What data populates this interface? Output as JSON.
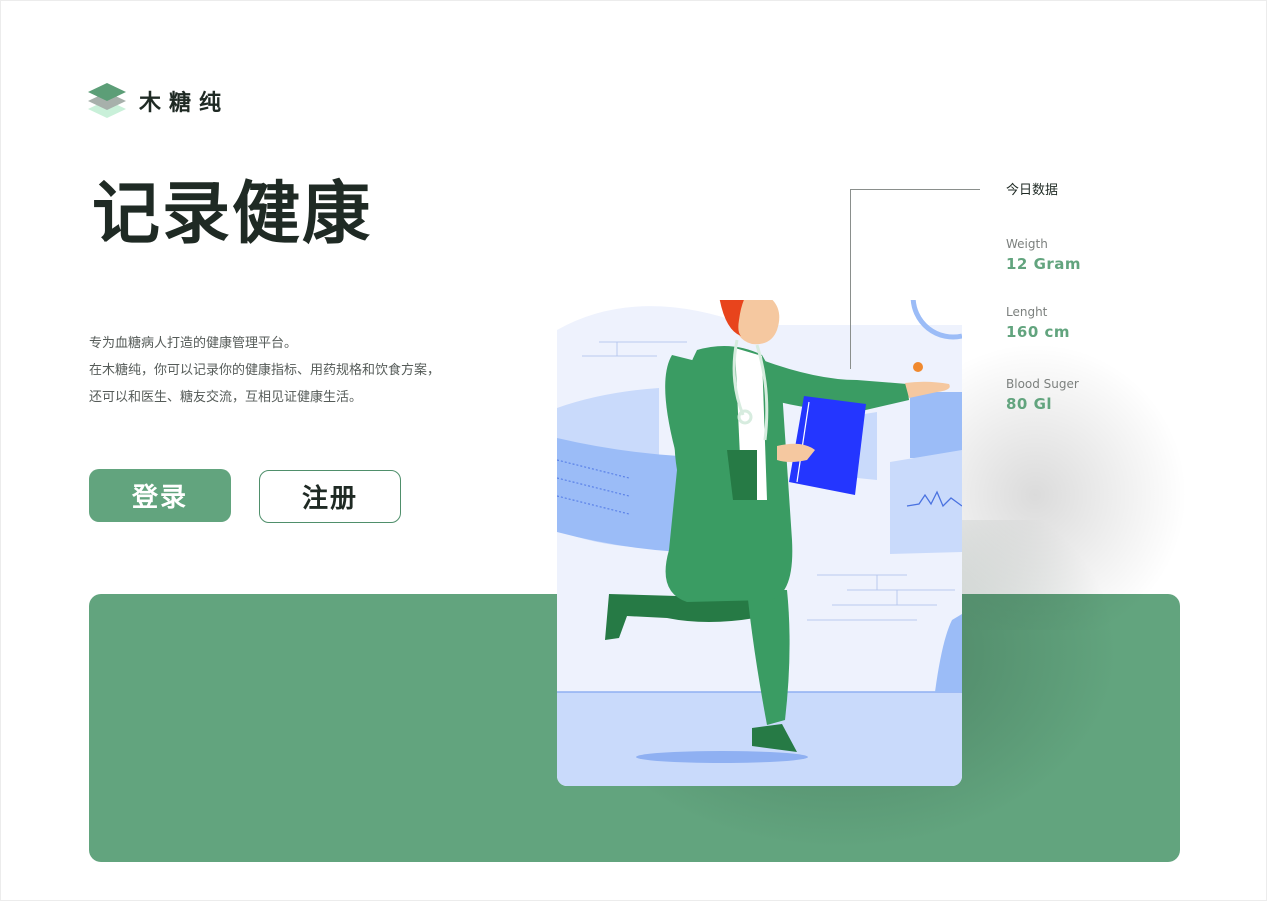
{
  "brand": {
    "name": "木糖纯"
  },
  "hero": {
    "title": "记录健康"
  },
  "description": {
    "lines": [
      "专为血糖病人打造的健康管理平台。",
      "在木糖纯，你可以记录你的健康指标、用药规格和饮食方案，",
      "还可以和医生、糖友交流，互相见证健康生活。"
    ]
  },
  "actions": {
    "login_label": "登录",
    "register_label": "注册"
  },
  "today": {
    "title": "今日数据",
    "stats": [
      {
        "label": "Weigth",
        "value": "12 Gram"
      },
      {
        "label": "Lenght",
        "value": "160 cm"
      },
      {
        "label": "Blood Suger",
        "value": "80 Gl"
      }
    ]
  },
  "colors": {
    "accent": "#62a47e",
    "dark_text": "#1f2a24",
    "illustration_bg": "#eef2fd",
    "illustration_blue": "#9bbcf7",
    "folder_blue": "#2436ff",
    "hair": "#e8441c"
  },
  "icons": {
    "logo": "stacked-layers-icon"
  }
}
